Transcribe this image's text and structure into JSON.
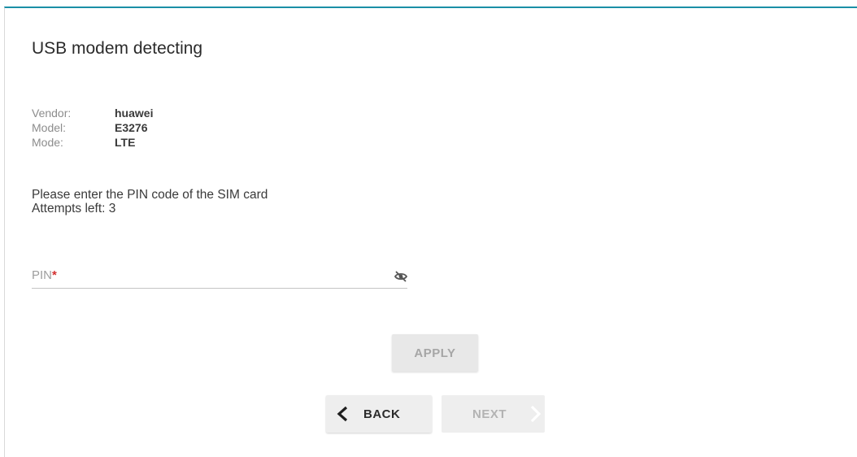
{
  "page": {
    "title": "USB modem detecting"
  },
  "modem": {
    "rows": [
      {
        "label": "Vendor:",
        "value": "huawei"
      },
      {
        "label": "Model:",
        "value": "E3276"
      },
      {
        "label": "Mode:",
        "value": "LTE"
      }
    ]
  },
  "message": {
    "line1": "Please enter the PIN code of the SIM card",
    "line2": "Attempts left: 3"
  },
  "pin": {
    "label": "PIN",
    "required_mark": "*",
    "value": "",
    "toggle_icon": "eye-off-icon"
  },
  "buttons": {
    "apply": "APPLY",
    "back": "BACK",
    "next": "NEXT"
  },
  "colors": {
    "accent": "#1a8fa6",
    "required": "#d32f2f",
    "disabled_text": "#a6a6a6"
  }
}
